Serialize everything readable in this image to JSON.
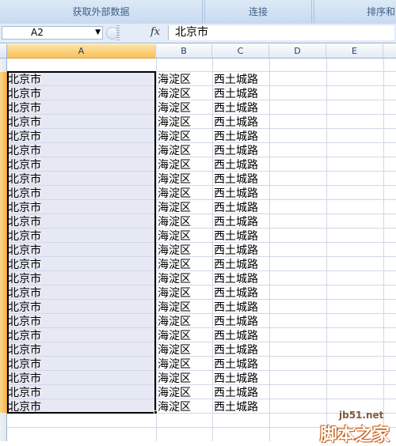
{
  "ribbon": {
    "groups": [
      "获取外部数据",
      "连接",
      "排序和"
    ]
  },
  "formula_bar": {
    "name_box": "A2",
    "fx_label": "fx",
    "content": "北京市"
  },
  "columns": [
    "A",
    "B",
    "C",
    "D",
    "E"
  ],
  "selected_column": "A",
  "active_cell": "A2",
  "selection_range": "A2:A25",
  "rows": {
    "count": 24,
    "col_a": "北京市",
    "col_b": "海淀区",
    "col_c": "西土城路"
  },
  "watermark": {
    "line1": "jb51.net",
    "line2": "脚本之家"
  },
  "colors": {
    "selected_header": "#f8c05a",
    "selection_fill": "#e6e9f3",
    "grid": "#d0d7e5"
  }
}
